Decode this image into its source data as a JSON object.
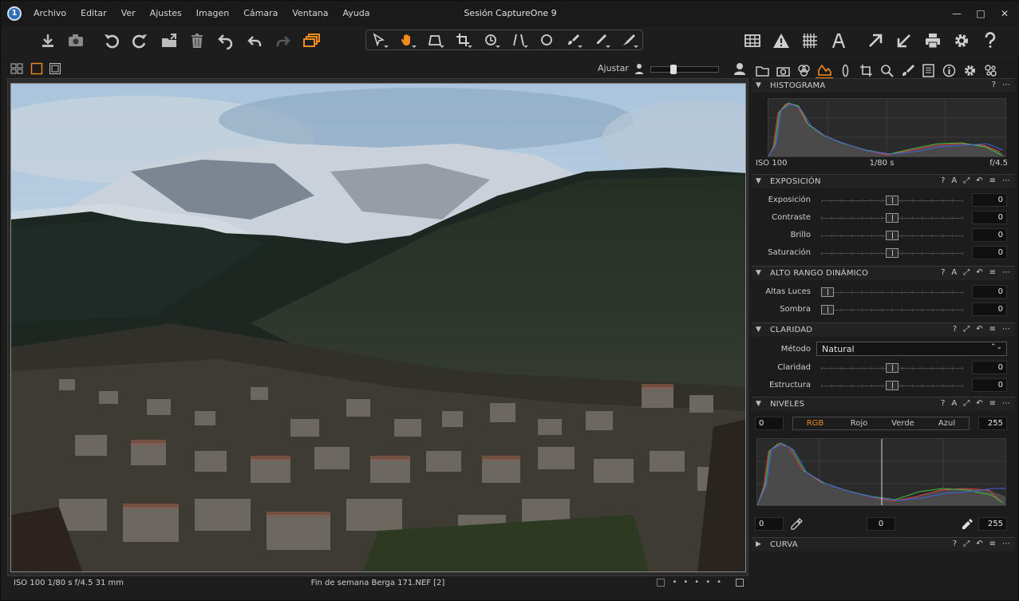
{
  "window": {
    "title": "Sesión CaptureOne 9",
    "app_logo_text": "1",
    "minimize": "—",
    "maximize": "□",
    "close": "✕"
  },
  "menu": [
    "Archivo",
    "Editar",
    "Ver",
    "Ajustes",
    "Imagen",
    "Cámara",
    "Ventana",
    "Ayuda"
  ],
  "icons": {
    "toolbar_left": [
      "import-icon",
      "camera-icon",
      "rotate-left-icon",
      "rotate-right-icon",
      "export-icon",
      "trash-icon",
      "undo-all-icon",
      "undo-icon",
      "redo-icon",
      "variants-icon"
    ],
    "tools": [
      "select-cursor-icon",
      "pan-hand-icon",
      "loupe-icon",
      "crop-icon",
      "rotate-tool-icon",
      "keystone-icon",
      "circle-mask-icon",
      "brush-icon",
      "picker-icon",
      "eraser-icon"
    ],
    "toolbar_right": [
      "grid-icon",
      "warning-icon",
      "focus-grid-icon",
      "text-icon",
      "arrow-up-icon",
      "arrow-down-icon",
      "print-icon",
      "settings-icon",
      "help-icon"
    ],
    "panel_tabs": [
      "folder-tab-icon",
      "camera-tab-icon",
      "color-tab-icon",
      "exposure-tab-icon",
      "lens-tab-icon",
      "crop-tab-icon",
      "details-tab-icon",
      "local-adjust-tab-icon",
      "metadata-tab-icon",
      "info-tab-icon",
      "settings-tab-icon",
      "batch-tab-icon"
    ]
  },
  "colors": {
    "accent": "#f08a1c",
    "bg": "#1d1d1d"
  },
  "viewer": {
    "adjust_label": "Ajustar",
    "zoom_level": 0.32
  },
  "status": {
    "meta": "ISO 100  1/80 s  f/4.5  31 mm",
    "filename": "Fin de semana Berga 171.NEF [2]"
  },
  "histogram": {
    "section": "HISTOGRAMA",
    "iso": "ISO 100",
    "shutter": "1/80 s",
    "aperture": "f/4.5"
  },
  "exposure": {
    "section": "EXPOSICIÓN",
    "rows": [
      {
        "label": "Exposición",
        "value": "0",
        "level": 0.5
      },
      {
        "label": "Contraste",
        "value": "0",
        "level": 0.5
      },
      {
        "label": "Brillo",
        "value": "0",
        "level": 0.5
      },
      {
        "label": "Saturación",
        "value": "0",
        "level": 0.5
      }
    ]
  },
  "hdr": {
    "section": "ALTO RANGO DINÁMICO",
    "rows": [
      {
        "label": "Altas Luces",
        "value": "0",
        "level": 0
      },
      {
        "label": "Sombra",
        "value": "0",
        "level": 0
      }
    ]
  },
  "clarity": {
    "section": "CLARIDAD",
    "method_label": "Método",
    "method_value": "Natural",
    "rows": [
      {
        "label": "Claridad",
        "value": "0",
        "level": 0.5
      },
      {
        "label": "Estructura",
        "value": "0",
        "level": 0.5
      }
    ]
  },
  "levels": {
    "section": "NIVELES",
    "input_low": "0",
    "input_high": "255",
    "channels": [
      "RGB",
      "Rojo",
      "Verde",
      "Azul"
    ],
    "output_low": "0",
    "midpoint": "0",
    "output_high": "255"
  },
  "curve": {
    "section": "CURVA"
  },
  "section_actions": {
    "help": "?",
    "auto": "A",
    "copy": "⤢",
    "reset": "↶",
    "menu": "≡",
    "more": "⋯"
  }
}
